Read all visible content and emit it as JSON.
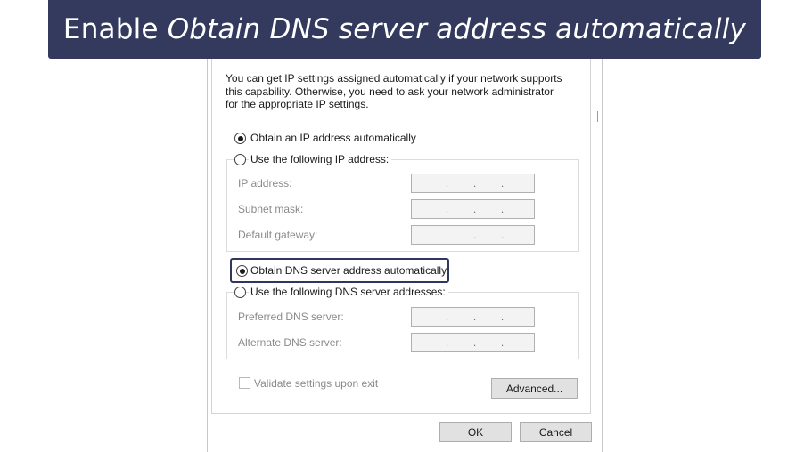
{
  "banner": {
    "prefix": "Enable",
    "emphasis": "Obtain DNS server address automatically"
  },
  "dialog": {
    "description_lines": [
      "You can get IP settings assigned automatically if your network supports",
      "this capability. Otherwise, you need to ask your network administrator",
      "for the appropriate IP settings."
    ],
    "ip_auto_label": "Obtain an IP address automatically",
    "ip_manual_label": "Use the following IP address:",
    "ip_mode": "automatic",
    "ip_fields": [
      {
        "label": "IP address:",
        "value": ". . ."
      },
      {
        "label": "Subnet mask:",
        "value": ". . ."
      },
      {
        "label": "Default gateway:",
        "value": ". . ."
      }
    ],
    "dns_auto_label": "Obtain DNS server address automatically",
    "dns_manual_label": "Use the following DNS server addresses:",
    "dns_mode": "automatic",
    "dns_fields": [
      {
        "label": "Preferred DNS server:",
        "value": ". . ."
      },
      {
        "label": "Alternate DNS server:",
        "value": ". . ."
      }
    ],
    "validate_label": "Validate settings upon exit",
    "validate_checked": false,
    "advanced_label": "Advanced...",
    "ok_label": "OK",
    "cancel_label": "Cancel"
  },
  "colors": {
    "banner_bg": "#333a5e",
    "highlight_border": "#2f3660"
  }
}
